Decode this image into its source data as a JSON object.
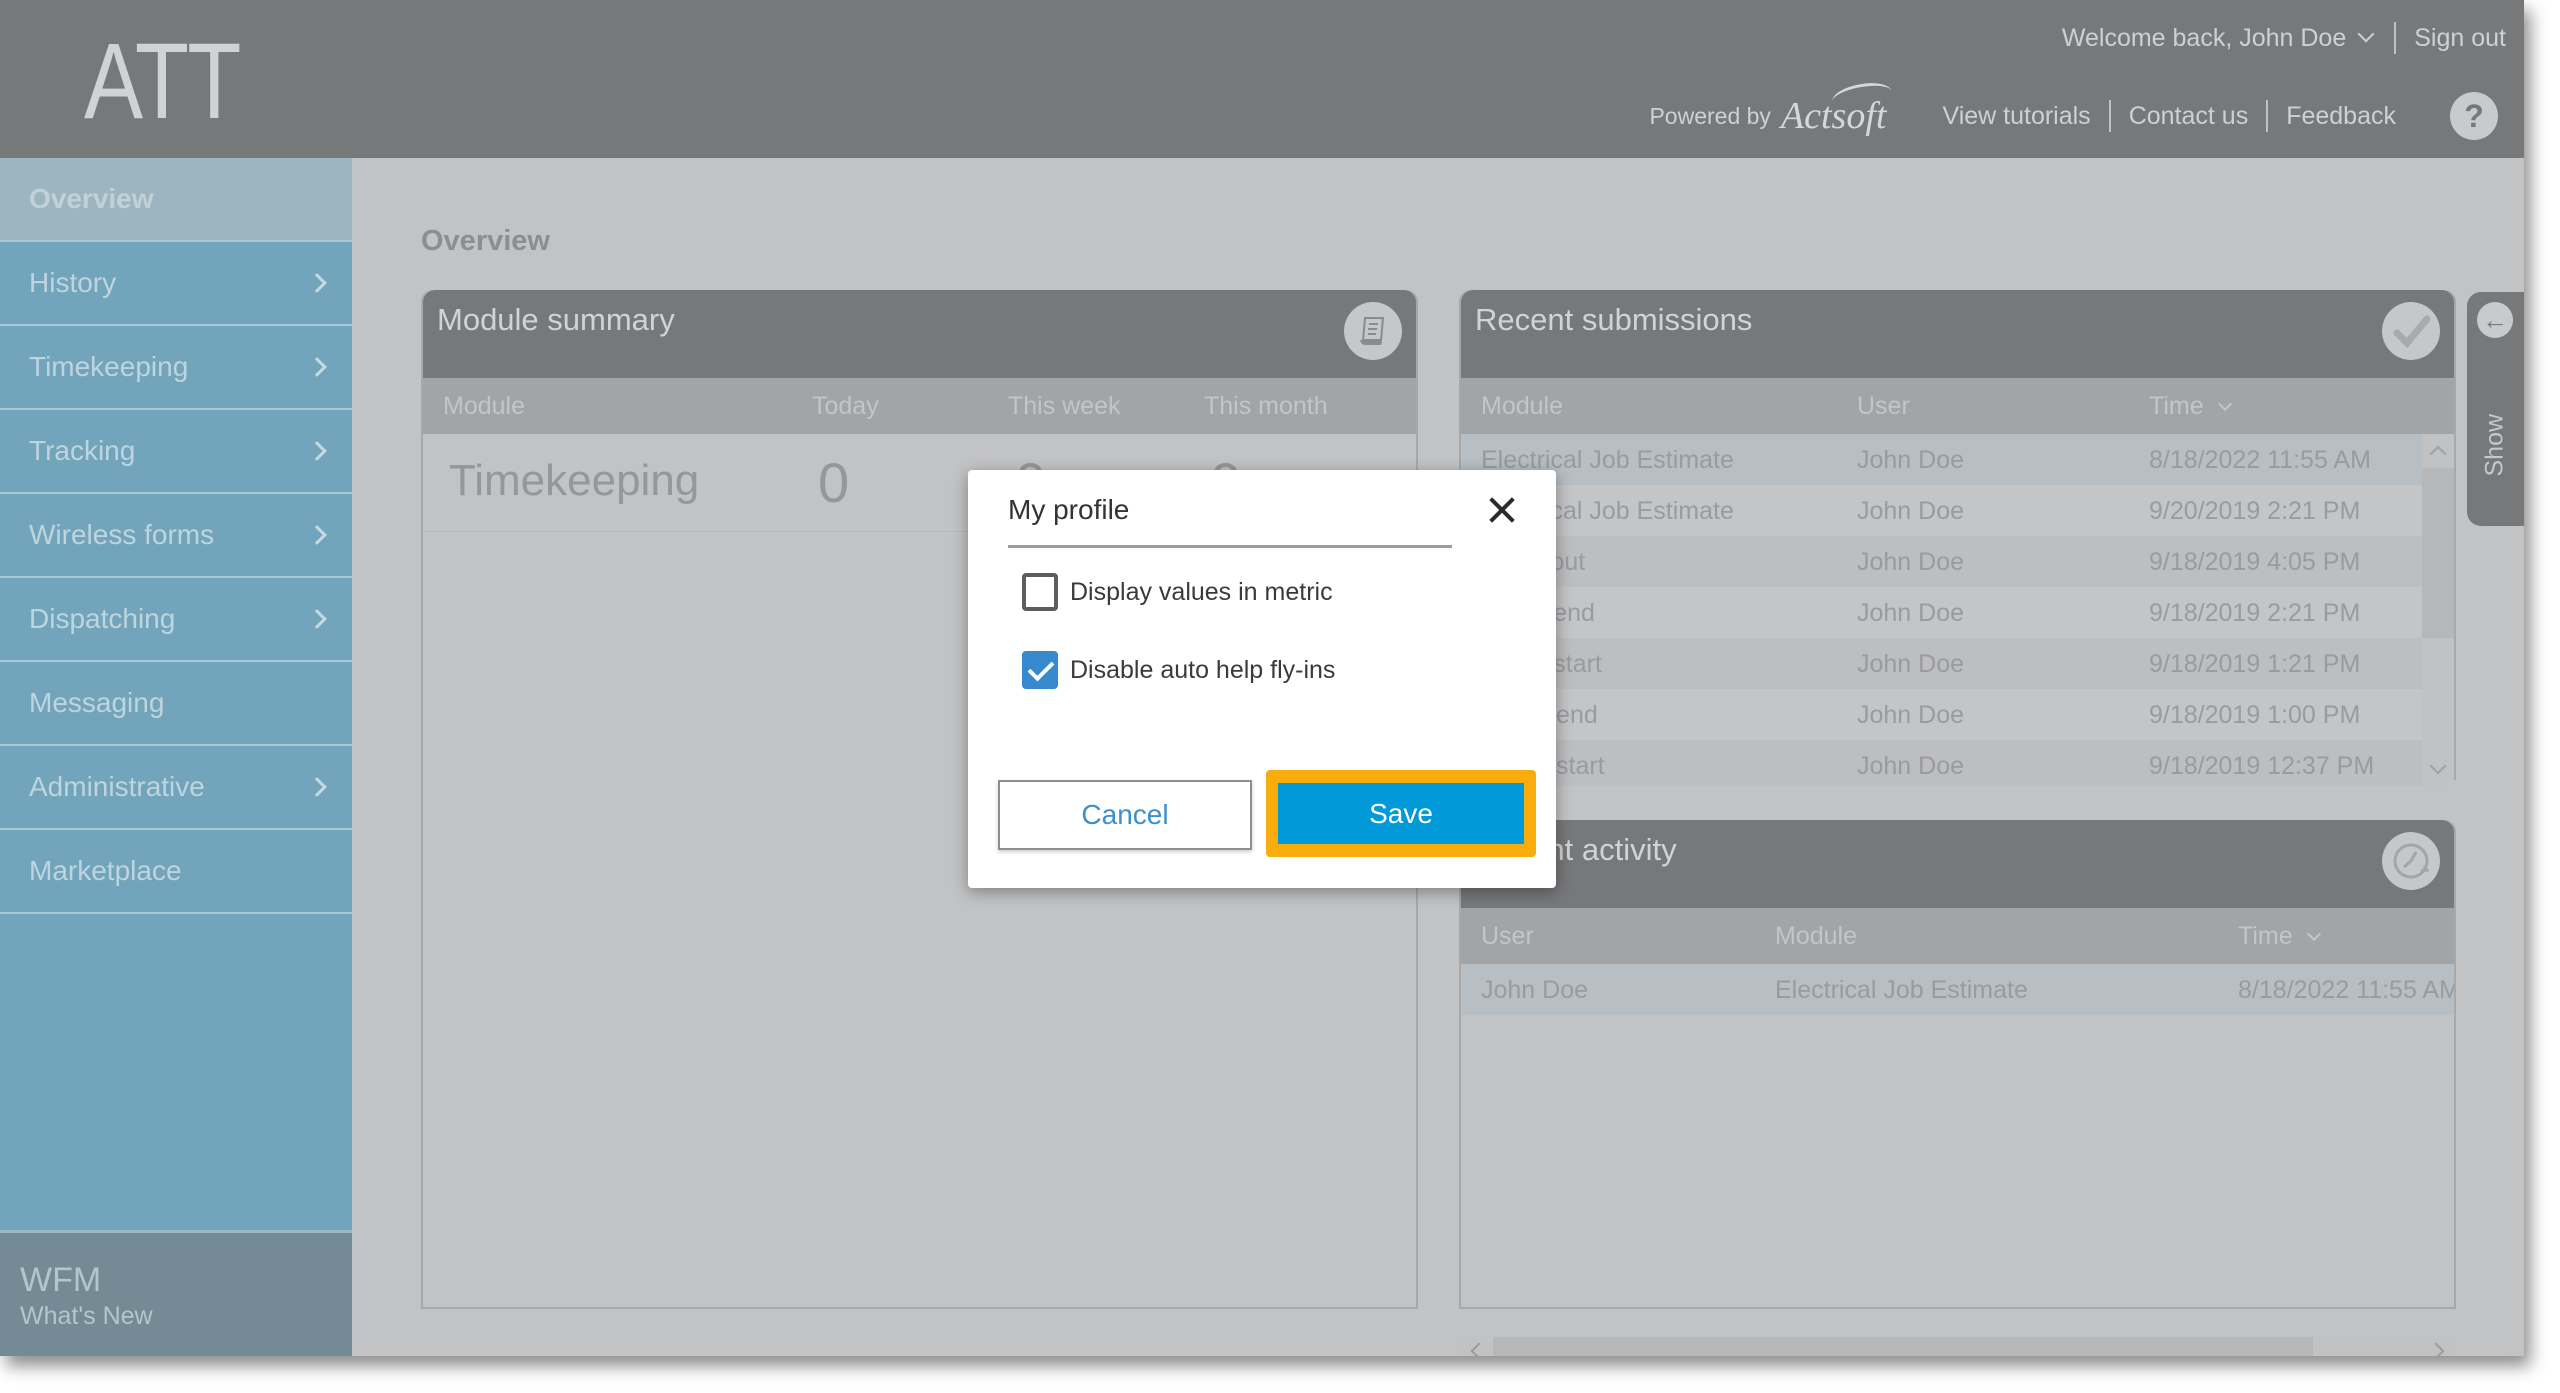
{
  "header": {
    "logo": "ATT",
    "welcome": "Welcome back, John Doe",
    "sign_out": "Sign out",
    "powered_by": "Powered by",
    "brand": "Actsoft",
    "links": [
      "View tutorials",
      "Contact us",
      "Feedback"
    ],
    "help_glyph": "?"
  },
  "sidebar": {
    "items": [
      {
        "label": "Overview",
        "active": true,
        "has_submenu": false
      },
      {
        "label": "History",
        "has_submenu": true
      },
      {
        "label": "Timekeeping",
        "has_submenu": true
      },
      {
        "label": "Tracking",
        "has_submenu": true
      },
      {
        "label": "Wireless forms",
        "has_submenu": true
      },
      {
        "label": "Dispatching",
        "has_submenu": true
      },
      {
        "label": "Messaging",
        "has_submenu": false
      },
      {
        "label": "Administrative",
        "has_submenu": true
      },
      {
        "label": "Marketplace",
        "has_submenu": false
      }
    ],
    "footer": {
      "title": "WFM",
      "subtitle": "What's New"
    }
  },
  "main": {
    "page_title": "Overview",
    "module_summary": {
      "title": "Module summary",
      "icon": "report-icon",
      "columns": [
        "Module",
        "Today",
        "This week",
        "This month"
      ],
      "rows": [
        {
          "module": "Timekeeping",
          "today": "0",
          "this_week": "0",
          "this_month": "0"
        }
      ]
    },
    "recent_submissions": {
      "title": "Recent submissions",
      "icon": "checkmark-icon",
      "columns": [
        "Module",
        "User",
        "Time"
      ],
      "rows": [
        {
          "module": "Electrical Job Estimate",
          "user": "John Doe",
          "time": "8/18/2022 11:55 AM"
        },
        {
          "module": "Electrical Job Estimate",
          "user": "John Doe",
          "time": "9/20/2019 2:21 PM"
        },
        {
          "module": "Clock out",
          "user": "John Doe",
          "time": "9/18/2019 4:05 PM"
        },
        {
          "module": "Break end",
          "user": "John Doe",
          "time": "9/18/2019 2:21 PM"
        },
        {
          "module": "Break start",
          "user": "John Doe",
          "time": "9/18/2019 1:21 PM"
        },
        {
          "module": "Lunch end",
          "user": "John Doe",
          "time": "9/18/2019 1:00 PM"
        },
        {
          "module": "Lunch start",
          "user": "John Doe",
          "time": "9/18/2019 12:37 PM"
        }
      ]
    },
    "recent_activity": {
      "title": "Recent activity",
      "icon": "clock-icon",
      "columns": [
        "User",
        "Module",
        "Time"
      ],
      "rows": [
        {
          "user": "John Doe",
          "module": "Electrical Job Estimate",
          "time": "8/18/2022 11:55 AM"
        }
      ]
    },
    "show_tab": {
      "label": "Show"
    }
  },
  "dialog": {
    "title": "My profile",
    "options": [
      {
        "label": "Display values in metric",
        "checked": false
      },
      {
        "label": "Disable auto help fly-ins",
        "checked": true
      }
    ],
    "cancel_label": "Cancel",
    "save_label": "Save"
  },
  "colors": {
    "accent": "#009ad8",
    "highlight": "#f9ad0c",
    "sidebar": "#72a5bb",
    "header": "#77787a",
    "checkbox": "#3589cc"
  }
}
